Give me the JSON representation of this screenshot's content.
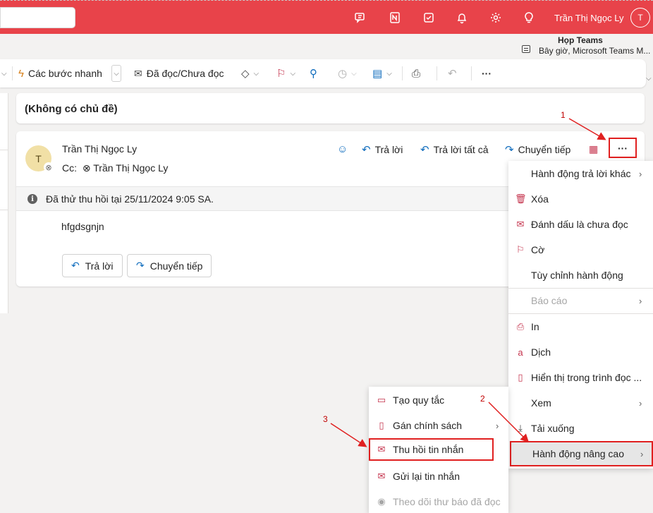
{
  "header": {
    "user_name": "Trần Thị Ngọc Ly",
    "user_initial": "T",
    "icons": [
      "teams-chat-icon",
      "onenote-icon",
      "todo-icon",
      "bell-icon",
      "gear-icon",
      "lightbulb-icon"
    ]
  },
  "meeting": {
    "title": "Họp Teams",
    "subtitle": "Bây giờ, Microsoft Teams M..."
  },
  "toolbar": {
    "quick_steps": "Các bước nhanh",
    "read_unread": "Đã đọc/Chưa đọc",
    "more": "···"
  },
  "subject": "(Không có chủ đề)",
  "message": {
    "sender": "Trần Thị Ngọc Ly",
    "avatar_initial": "T",
    "cc_label": "Cc:",
    "cc_name": "Trần Thị Ngọc Ly",
    "actions": {
      "reply": "Trả lời",
      "reply_all": "Trả lời tất cả",
      "forward": "Chuyển tiếp"
    },
    "info": "Đã thử thu hồi tại 25/11/2024 9:05 SA.",
    "body": "hfgdsgnjn",
    "buttons": {
      "reply": "Trả lời",
      "forward": "Chuyển tiếp"
    },
    "more_label": "···"
  },
  "menu": {
    "items": [
      {
        "label": "Hành động trả lời khác",
        "icon": "",
        "submenu": true
      },
      {
        "label": "Xóa",
        "icon": "trash-icon"
      },
      {
        "label": "Đánh dấu là chưa đọc",
        "icon": "envelope-icon"
      },
      {
        "label": "Cờ",
        "icon": "flag-icon"
      },
      {
        "label": "Tùy chỉnh hành động",
        "icon": ""
      },
      {
        "label": "Báo cáo",
        "icon": "",
        "submenu": true,
        "disabled": true
      },
      {
        "label": "In",
        "icon": "printer-icon"
      },
      {
        "label": "Dịch",
        "icon": "translate-icon"
      },
      {
        "label": "Hiển thị trong trình đọc ...",
        "icon": "immersive-reader-icon"
      },
      {
        "label": "Xem",
        "icon": "",
        "submenu": true
      },
      {
        "label": "Tải xuống",
        "icon": "download-icon"
      },
      {
        "label": "Hành động nâng cao",
        "icon": "",
        "submenu": true,
        "highlighted": true
      }
    ]
  },
  "submenu": {
    "items": [
      {
        "label": "Tạo quy tắc",
        "icon": "rule-icon"
      },
      {
        "label": "Gán chính sách",
        "icon": "policy-icon",
        "submenu": true
      },
      {
        "label": "Thu hồi tin nhắn",
        "icon": "recall-icon",
        "highlighted": true
      },
      {
        "label": "Gửi lại tin nhắn",
        "icon": "resend-icon"
      },
      {
        "label": "Theo dõi thư báo đã đọc",
        "icon": "read-receipt-icon",
        "disabled": true
      }
    ]
  },
  "annotations": {
    "step1": "1",
    "step2": "2",
    "step3": "3",
    "color": "#e02020"
  },
  "colors": {
    "header": "#e8434a",
    "accent": "#0f6cbd",
    "menu_icon": "#c4314b"
  }
}
